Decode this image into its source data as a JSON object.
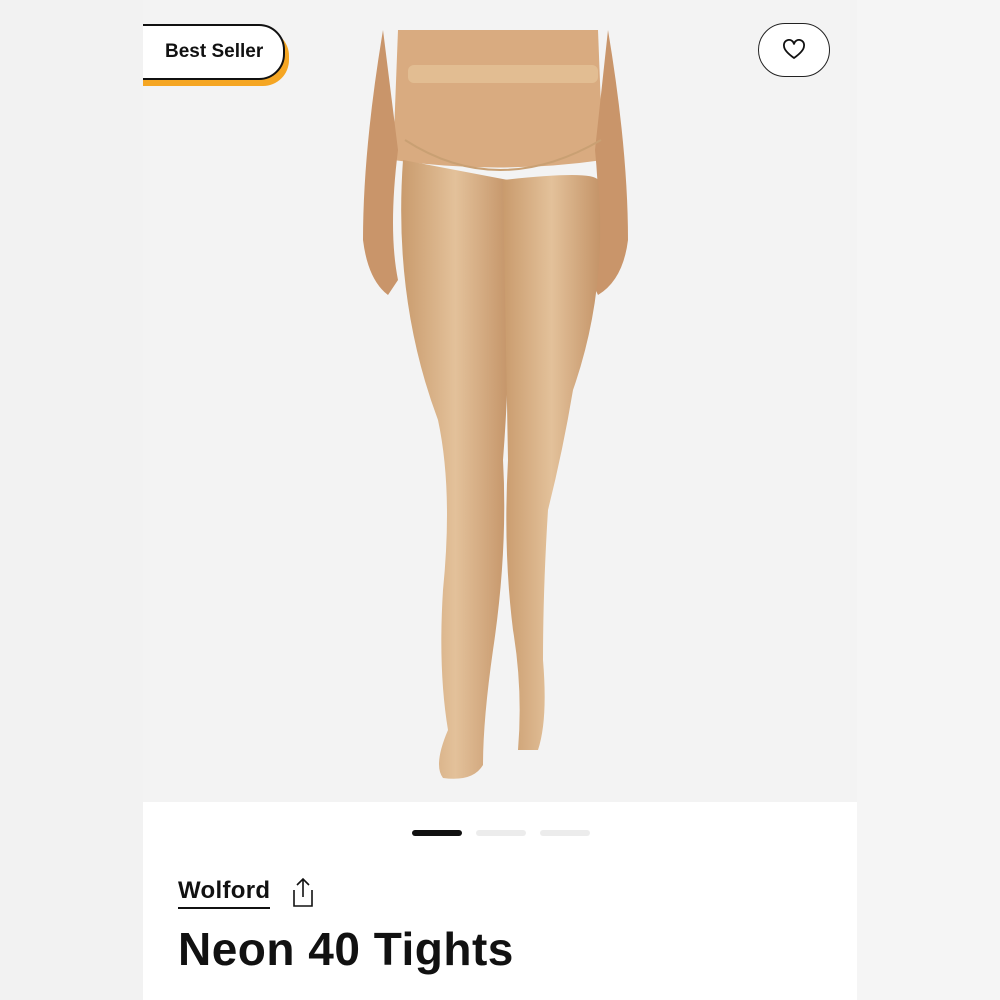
{
  "badge": {
    "label": "Best Seller"
  },
  "icons": {
    "favorite": "heart-icon",
    "share": "share-icon"
  },
  "carousel": {
    "total_pages": 3,
    "active_page": 1
  },
  "product": {
    "brand": "Wolford",
    "name": "Neon 40 Tights"
  },
  "colors": {
    "accent": "#f5a623",
    "text": "#111111",
    "tights": "#d8b48a"
  }
}
